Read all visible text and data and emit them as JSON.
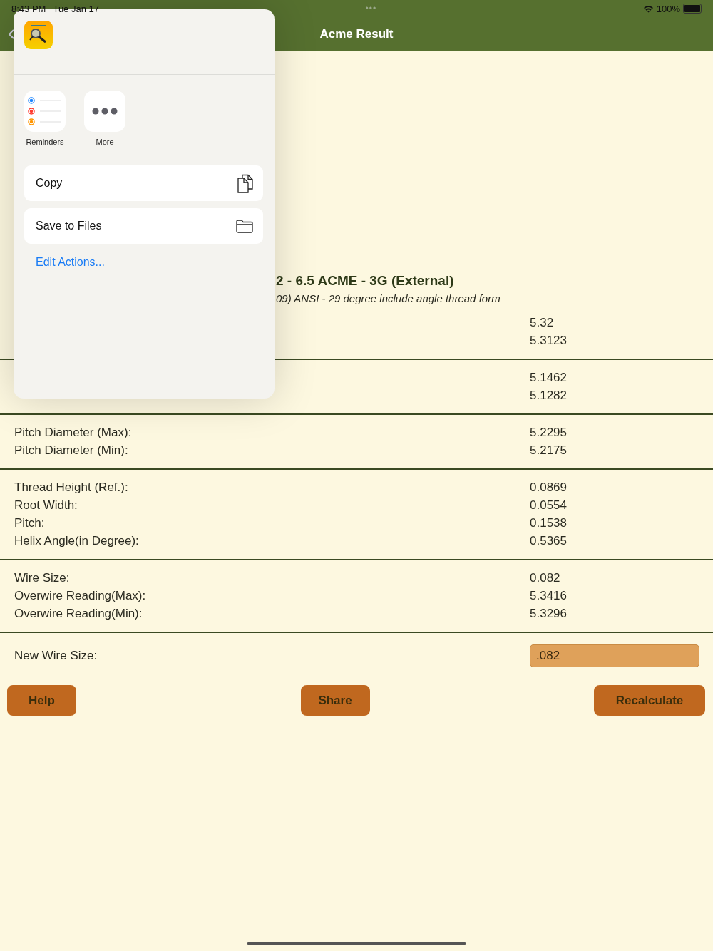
{
  "status_bar": {
    "time": "8:43 PM",
    "date": "Tue Jan 17",
    "dots": "•••",
    "battery": "100%"
  },
  "nav": {
    "title": "Acme Result"
  },
  "result": {
    "title": "2 - 6.5 ACME - 3G (External)",
    "subtitle": "09) ANSI - 29 degree include angle thread form",
    "sections": [
      {
        "rows": [
          {
            "value": "5.32"
          },
          {
            "value": "5.3123"
          }
        ]
      },
      {
        "rows": [
          {
            "value": "5.1462"
          },
          {
            "value": "5.1282"
          }
        ]
      },
      {
        "rows": [
          {
            "label": "Pitch Diameter (Max):",
            "value": "5.2295"
          },
          {
            "label": "Pitch Diameter (Min):",
            "value": "5.2175"
          }
        ]
      },
      {
        "rows": [
          {
            "label": "Thread Height (Ref.):",
            "value": "0.0869"
          },
          {
            "label": "Root Width:",
            "value": "0.0554"
          },
          {
            "label": "Pitch:",
            "value": "0.1538"
          },
          {
            "label": "Helix Angle(in Degree):",
            "value": "0.5365"
          }
        ]
      },
      {
        "rows": [
          {
            "label": "Wire Size:",
            "value": "0.082"
          },
          {
            "label": "Overwire Reading(Max):",
            "value": "5.3416"
          },
          {
            "label": "Overwire Reading(Min):",
            "value": "5.3296"
          }
        ]
      }
    ],
    "input": {
      "label": "New Wire Size:",
      "value": ".082"
    },
    "buttons": [
      "Help",
      "Share",
      "Recalculate"
    ]
  },
  "share_sheet": {
    "apps": [
      {
        "kind": "reminders",
        "label": "Reminders"
      },
      {
        "kind": "more",
        "label": "More"
      }
    ],
    "actions": [
      {
        "kind": "copy",
        "label": "Copy"
      },
      {
        "kind": "folder",
        "label": "Save to Files"
      }
    ],
    "edit_link": "Edit Actions..."
  }
}
